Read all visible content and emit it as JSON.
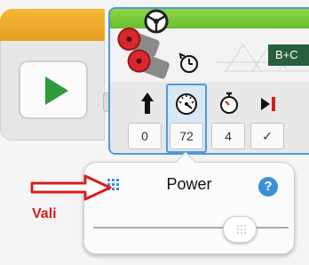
{
  "motor_block": {
    "port": "B+C",
    "params": [
      {
        "icon": "up-arrow-icon",
        "value": "0"
      },
      {
        "icon": "speed-gauge-icon",
        "value": "72"
      },
      {
        "icon": "stopwatch-icon",
        "value": "4"
      },
      {
        "icon": "brake-icon",
        "value": "✓"
      }
    ]
  },
  "popup": {
    "title": "Power",
    "help": "?",
    "slider_fraction": 0.75
  },
  "annotation": {
    "label": "Vali",
    "color": "#d61e1e"
  },
  "colors": {
    "start_orange": "#f6b738",
    "motor_green": "#58b52a",
    "play_green": "#2e9a3a",
    "selection_blue": "#4f9ad8",
    "help_blue": "#3b8fd6"
  }
}
